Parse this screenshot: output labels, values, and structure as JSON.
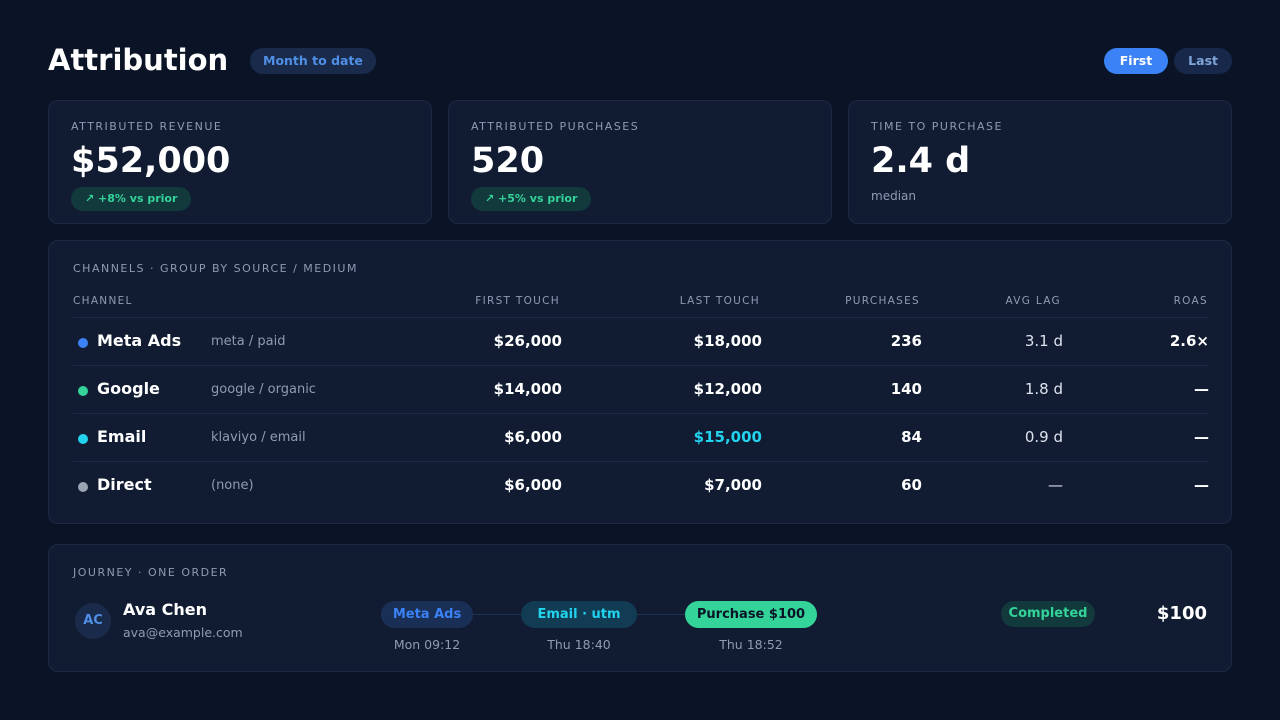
{
  "header": {
    "title": "Attribution",
    "period": "Month to date",
    "toggle": {
      "first": "First",
      "last": "Last",
      "active": "First"
    }
  },
  "kpis": [
    {
      "label": "ATTRIBUTED REVENUE",
      "value": "$52,000",
      "delta": "↗ +8% vs prior"
    },
    {
      "label": "ATTRIBUTED PURCHASES",
      "value": "520",
      "delta": "↗ +5% vs prior"
    },
    {
      "label": "TIME TO PURCHASE",
      "value": "2.4 d",
      "note": "median"
    }
  ],
  "channels": {
    "section_label": "CHANNELS · GROUP BY SOURCE / MEDIUM",
    "columns": [
      "CHANNEL",
      "FIRST TOUCH",
      "LAST TOUCH",
      "PURCHASES",
      "AVG LAG",
      "ROAS"
    ],
    "rows": [
      {
        "name": "Meta Ads",
        "source": "meta / paid",
        "color": "#3b82f6",
        "first": "$26,000",
        "last": "$18,000",
        "purchases": "236",
        "lag": "3.1 d",
        "roas": "2.6×"
      },
      {
        "name": "Google",
        "source": "google / organic",
        "color": "#34d399",
        "first": "$14,000",
        "last": "$12,000",
        "purchases": "140",
        "lag": "1.8 d",
        "roas": "—"
      },
      {
        "name": "Email",
        "source": "klaviyo / email",
        "color": "#22d3ee",
        "first": "$6,000",
        "last": "$15,000",
        "purchases": "84",
        "lag": "0.9 d",
        "roas": "—"
      },
      {
        "name": "Direct",
        "source": "(none)",
        "color": "#9aa3b2",
        "first": "$6,000",
        "last": "$7,000",
        "purchases": "60",
        "lag": "—",
        "roas": "—"
      }
    ]
  },
  "journey": {
    "section_label": "JOURNEY · ONE ORDER",
    "customer": {
      "initials": "AC",
      "name": "Ava Chen",
      "email": "ava@example.com"
    },
    "steps": [
      {
        "label": "Meta Ads",
        "time": "Mon 09:12"
      },
      {
        "label": "Email · utm",
        "time": "Thu 18:40"
      },
      {
        "label": "Purchase $100",
        "time": "Thu 18:52"
      }
    ],
    "status": "Completed",
    "total": "$100"
  }
}
